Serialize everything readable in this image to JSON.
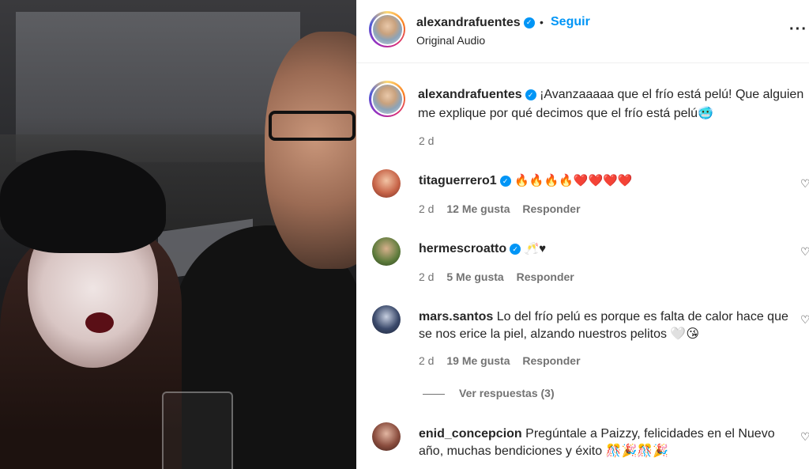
{
  "post": {
    "username": "alexandrafuentes",
    "follow_label": "Seguir",
    "separator": "•",
    "audio": "Original Audio",
    "more_label": "···"
  },
  "caption": {
    "username": "alexandrafuentes",
    "text": "¡Avanzaaaaa que el frío está pelú! Que alguien me explique por qué decimos que el frío está pelú🥶",
    "time": "2 d"
  },
  "comments": [
    {
      "username": "titaguerrero1",
      "verified": true,
      "text": "🔥🔥🔥🔥❤️❤️❤️❤️",
      "time": "2 d",
      "likes": "12 Me gusta",
      "reply": "Responder",
      "avatar_color": "#c8664a"
    },
    {
      "username": "hermescroatto",
      "verified": true,
      "text": "🥂♥",
      "time": "2 d",
      "likes": "5 Me gusta",
      "reply": "Responder",
      "avatar_color": "#5b7a3a"
    },
    {
      "username": "mars.santos",
      "verified": false,
      "text": "Lo del frío pelú es porque es falta de calor hace que se nos erice la piel, alzando nuestros pelitos 🤍😘",
      "time": "2 d",
      "likes": "19 Me gusta",
      "reply": "Responder",
      "view_replies": "Ver respuestas (3)",
      "avatar_color": "#3b4a6b"
    },
    {
      "username": "enid_concepcion",
      "verified": false,
      "text": "Pregúntale a Paizzy, felicidades en el Nuevo año, muchas bendiciones y éxito 🎊🎉🎊🎉",
      "avatar_color": "#8a4d3e"
    }
  ],
  "icons": {
    "heart": "heart-outline-icon",
    "verified": "verified-badge-icon",
    "more": "more-options-icon"
  },
  "colors": {
    "accent": "#0095f6",
    "muted": "#737373",
    "text": "#262626"
  }
}
